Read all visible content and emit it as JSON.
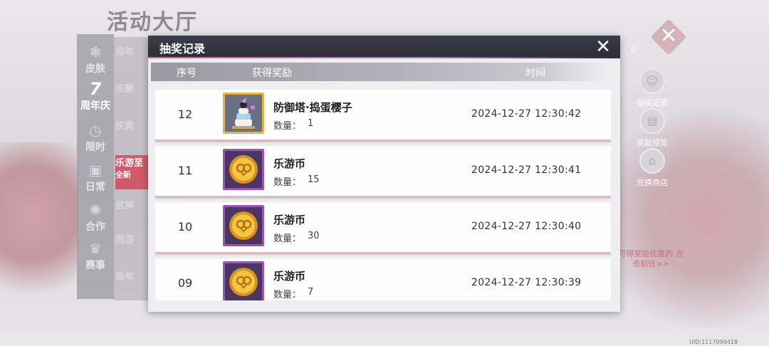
{
  "background": {
    "title": "活动大厅",
    "nav": [
      {
        "label": "皮肤",
        "icon": "butterfly-icon"
      },
      {
        "label": "周年庆",
        "icon": "number-seven-icon"
      },
      {
        "label": "限时",
        "icon": "clock-icon"
      },
      {
        "label": "日常",
        "icon": "gift-icon"
      },
      {
        "label": "合作",
        "icon": "handshake-icon"
      },
      {
        "label": "赛事",
        "icon": "trophy-icon"
      }
    ],
    "list_items": [
      "周年",
      "乐聚",
      "庆典",
      "乐游至",
      "武神",
      "同游",
      "周年"
    ],
    "active_list_item_sub": "全新",
    "zero_count": "0",
    "right_buttons": [
      "抽奖记录",
      "奖励预览",
      "兑换商店"
    ],
    "hint": "可得奖励优惠的 点击前往>>",
    "uid": "UID:1117099418"
  },
  "dialog": {
    "title": "抽奖记录",
    "columns": {
      "seq": "序号",
      "reward": "获得奖励",
      "time": "时间"
    },
    "qty_label": "数量：",
    "records": [
      {
        "seq": "12",
        "name": "防御塔·捣蛋樱子",
        "qty": "1",
        "time": "2024-12-27 12:30:42",
        "icon": "tower-cake-icon",
        "frame": "gold"
      },
      {
        "seq": "11",
        "name": "乐游币",
        "qty": "15",
        "time": "2024-12-27 12:30:41",
        "icon": "coin-icon",
        "frame": "purple"
      },
      {
        "seq": "10",
        "name": "乐游币",
        "qty": "30",
        "time": "2024-12-27 12:30:40",
        "icon": "coin-icon",
        "frame": "purple"
      },
      {
        "seq": "09",
        "name": "乐游币",
        "qty": "7",
        "time": "2024-12-27 12:30:39",
        "icon": "coin-icon",
        "frame": "purple"
      }
    ]
  },
  "colors": {
    "accent": "#d05a6a",
    "header": "#2b2c35",
    "frame_gold": "#e5b43b",
    "frame_purple": "#9b56b5"
  }
}
